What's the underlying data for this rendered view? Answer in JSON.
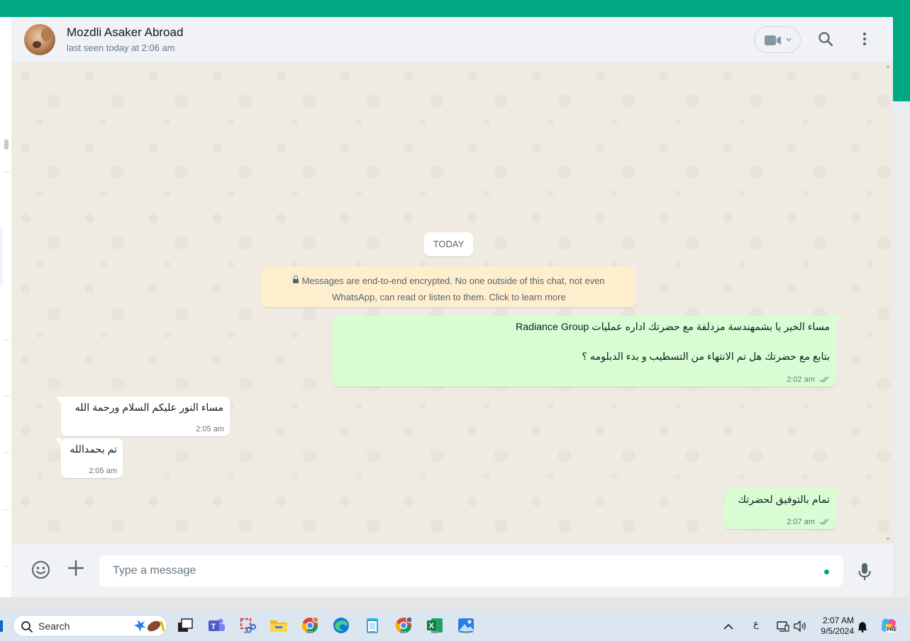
{
  "header": {
    "contact_name": "Mozdli Asaker Abroad",
    "last_seen": "last seen today at 2:06 am"
  },
  "chat": {
    "date_chip": "TODAY",
    "encryption_notice": "Messages are end-to-end encrypted. No one outside of this chat, not even WhatsApp, can read or listen to them. Click to learn more",
    "messages": [
      {
        "direction": "outgoing",
        "text": "مساء  الخير يا بشمهندسة مزدلفة مع  حضرتك اداره عمليات Radiance Group\n\nبتابع مع حضرتك هل تم الانتهاء من التسطيب و بدء الدبلومه ؟",
        "time": "2:02 am",
        "status": "read"
      },
      {
        "direction": "incoming",
        "text": "مساء النور عليكم السلام ورحمة الله",
        "time": "2:05 am"
      },
      {
        "direction": "incoming",
        "text": "تم بحمدالله",
        "time": "2:05 am"
      },
      {
        "direction": "outgoing",
        "text": "تمام بالتوفيق لحضرتك",
        "time": "2:07 am",
        "status": "read"
      }
    ]
  },
  "composer": {
    "placeholder": "Type a message"
  },
  "taskbar": {
    "search_label": "Search",
    "keyboard_lang": "ع",
    "clock_time": "2:07 AM",
    "clock_date": "9/5/2024",
    "copilot_badge": "PRE"
  },
  "colors": {
    "brand": "#00a884",
    "outgoing_bubble": "#d9fdd3",
    "incoming_bubble": "#ffffff",
    "encryption_banner": "#ffeecd",
    "read_ticks": "#8696a0"
  }
}
